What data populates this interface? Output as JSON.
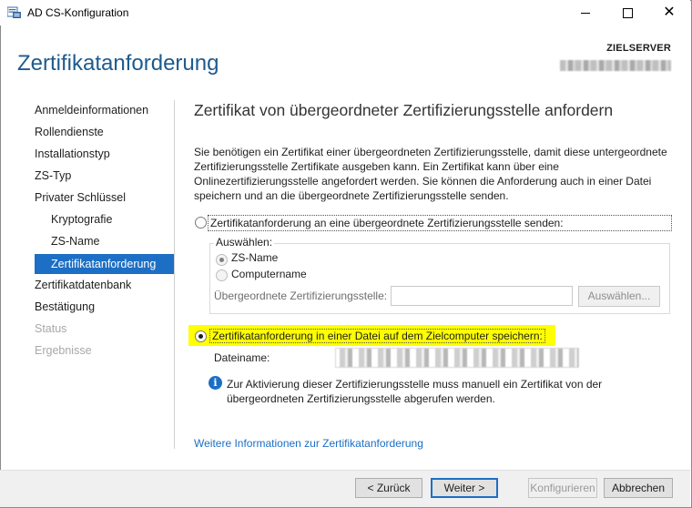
{
  "window": {
    "title": "AD CS-Konfiguration"
  },
  "header": {
    "title": "Zertifikatanforderung",
    "server_label": "ZIELSERVER"
  },
  "nav": {
    "items": [
      {
        "label": "Anmeldeinformationen"
      },
      {
        "label": "Rollendienste"
      },
      {
        "label": "Installationstyp"
      },
      {
        "label": "ZS-Typ"
      },
      {
        "label": "Privater Schlüssel"
      },
      {
        "label": "Kryptografie"
      },
      {
        "label": "ZS-Name"
      },
      {
        "label": "Zertifikatanforderung"
      },
      {
        "label": "Zertifikatdatenbank"
      },
      {
        "label": "Bestätigung"
      },
      {
        "label": "Status"
      },
      {
        "label": "Ergebnisse"
      }
    ]
  },
  "main": {
    "section_title": "Zertifikat von übergeordneter Zertifizierungsstelle anfordern",
    "description": "Sie benötigen ein Zertifikat einer übergeordneten Zertifizierungsstelle, damit diese untergeordnete Zertifizierungsstelle Zertifikate ausgeben kann. Ein Zertifikat kann über eine Onlinezertifizierungsstelle angefordert werden. Sie können die Anforderung auch in einer Datei speichern und an die übergeordnete Zertifizierungsstelle senden.",
    "option_send": "Zertifikatanforderung an eine übergeordnete Zertifizierungsstelle senden:",
    "select_group": {
      "legend": "Auswählen:",
      "by_ca_name": "ZS-Name",
      "by_computer_name": "Computername",
      "parent_ca_label": "Übergeordnete Zertifizierungsstelle:",
      "parent_ca_value": "",
      "select_button": "Auswählen..."
    },
    "option_save": "Zertifikatanforderung in einer Datei auf dem Zielcomputer speichern:",
    "filename_label": "Dateiname:",
    "info_text": "Zur Aktivierung dieser Zertifizierungsstelle muss manuell ein Zertifikat von der übergeordneten Zertifizierungsstelle abgerufen werden.",
    "more_info_link": "Weitere Informationen zur Zertifikatanforderung"
  },
  "footer": {
    "back": "< Zurück",
    "next": "Weiter >",
    "configure": "Konfigurieren",
    "cancel": "Abbrechen"
  },
  "colors": {
    "accent": "#1c6fc4",
    "header_title": "#1e5a8e",
    "highlight": "#ffff00"
  }
}
